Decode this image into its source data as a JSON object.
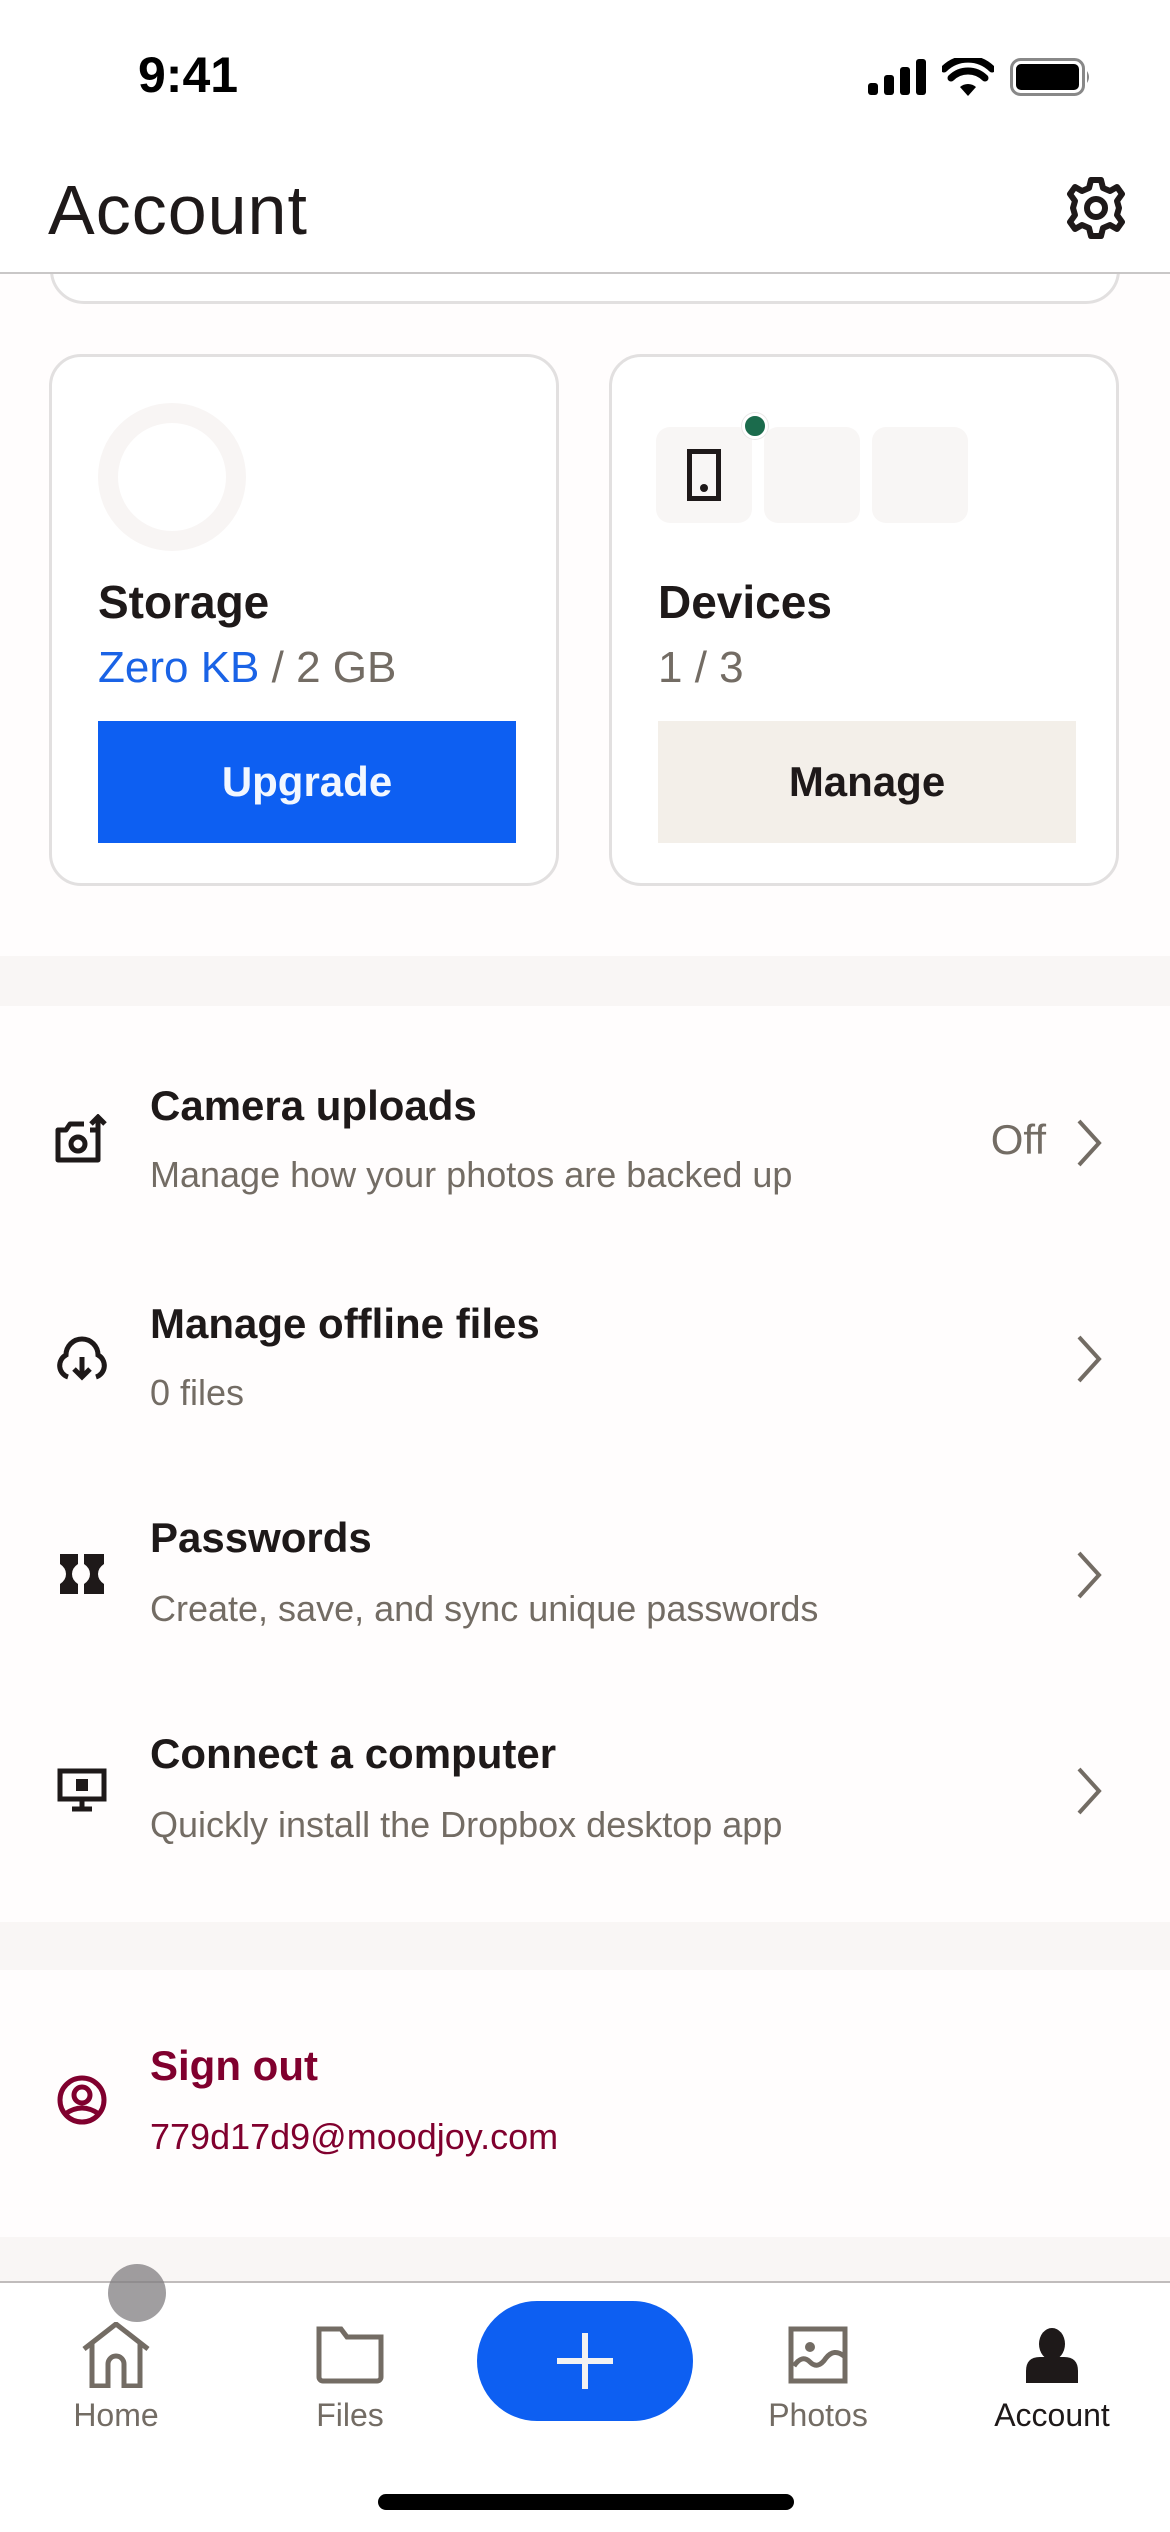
{
  "status_bar": {
    "time": "9:41",
    "icons": [
      "cellular-signal-icon",
      "wifi-icon",
      "battery-icon"
    ]
  },
  "header": {
    "title": "Account",
    "settings_icon": "gear-icon"
  },
  "storage_card": {
    "title": "Storage",
    "used": "Zero KB",
    "separator": " / ",
    "total": "2 GB",
    "usage_fraction": 0,
    "button_label": "Upgrade"
  },
  "devices_card": {
    "title": "Devices",
    "count_text": "1 / 3",
    "connected": 1,
    "limit": 3,
    "button_label": "Manage"
  },
  "list": [
    {
      "icon": "camera-upload-icon",
      "title": "Camera uploads",
      "subtitle": "Manage how your photos are backed up",
      "value": "Off"
    },
    {
      "icon": "cloud-download-icon",
      "title": "Manage offline files",
      "subtitle": "0 files",
      "value": ""
    },
    {
      "icon": "passwords-icon",
      "title": "Passwords",
      "subtitle": "Create, save, and sync unique passwords",
      "value": ""
    },
    {
      "icon": "desktop-computer-icon",
      "title": "Connect a computer",
      "subtitle": "Quickly install the Dropbox desktop app",
      "value": ""
    }
  ],
  "sign_out": {
    "title": "Sign out",
    "email": "779d17d9@moodjoy.com"
  },
  "tab_bar": {
    "tabs": [
      {
        "label": "Home",
        "icon": "home-icon",
        "active": false
      },
      {
        "label": "Files",
        "icon": "folder-icon",
        "active": false
      },
      {
        "label": "Photos",
        "icon": "photo-icon",
        "active": false
      },
      {
        "label": "Account",
        "icon": "person-icon",
        "active": true
      }
    ],
    "fab_icon": "plus-icon"
  },
  "colors": {
    "primary_blue": "#0d5ff2",
    "accent_blue_text": "#1a63e6",
    "sign_out_red": "#80002e",
    "device_online_green": "#1b6b4c",
    "manage_button_bg": "#f3efe9"
  }
}
